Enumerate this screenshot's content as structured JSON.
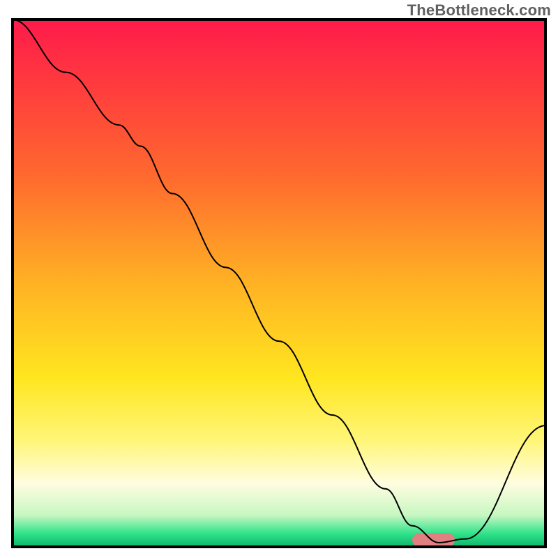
{
  "domain": "Chart",
  "watermark": "TheBottleneck.com",
  "chart_data": {
    "type": "line",
    "title": "",
    "xlabel": "",
    "ylabel": "",
    "xlim": [
      0,
      100
    ],
    "ylim": [
      0,
      100
    ],
    "background_gradient": {
      "stops": [
        {
          "offset": 0.0,
          "color": "#ff1a4b"
        },
        {
          "offset": 0.12,
          "color": "#ff3a3e"
        },
        {
          "offset": 0.3,
          "color": "#ff6a2e"
        },
        {
          "offset": 0.5,
          "color": "#ffb224"
        },
        {
          "offset": 0.68,
          "color": "#ffe61f"
        },
        {
          "offset": 0.8,
          "color": "#fff67a"
        },
        {
          "offset": 0.88,
          "color": "#fffde0"
        },
        {
          "offset": 0.94,
          "color": "#c7f7c2"
        },
        {
          "offset": 0.975,
          "color": "#2fe38a"
        },
        {
          "offset": 1.0,
          "color": "#0db36b"
        }
      ]
    },
    "series": [
      {
        "name": "bottleneck-curve",
        "color": "#000000",
        "width": 2,
        "x": [
          0,
          10,
          20,
          24,
          30,
          40,
          50,
          60,
          70,
          75,
          80,
          85,
          100
        ],
        "y": [
          100,
          90,
          80,
          76,
          67,
          53,
          39,
          25,
          11,
          4,
          0.8,
          1.5,
          23
        ]
      }
    ],
    "marker": {
      "name": "optimal-zone",
      "x_start": 75,
      "x_end": 83,
      "y": 1.3,
      "color": "#e08080",
      "radius_frac": 1.3
    },
    "borders": {
      "top": true,
      "bottom": true,
      "left": true,
      "right": true,
      "color": "#000000",
      "width": 4
    }
  }
}
